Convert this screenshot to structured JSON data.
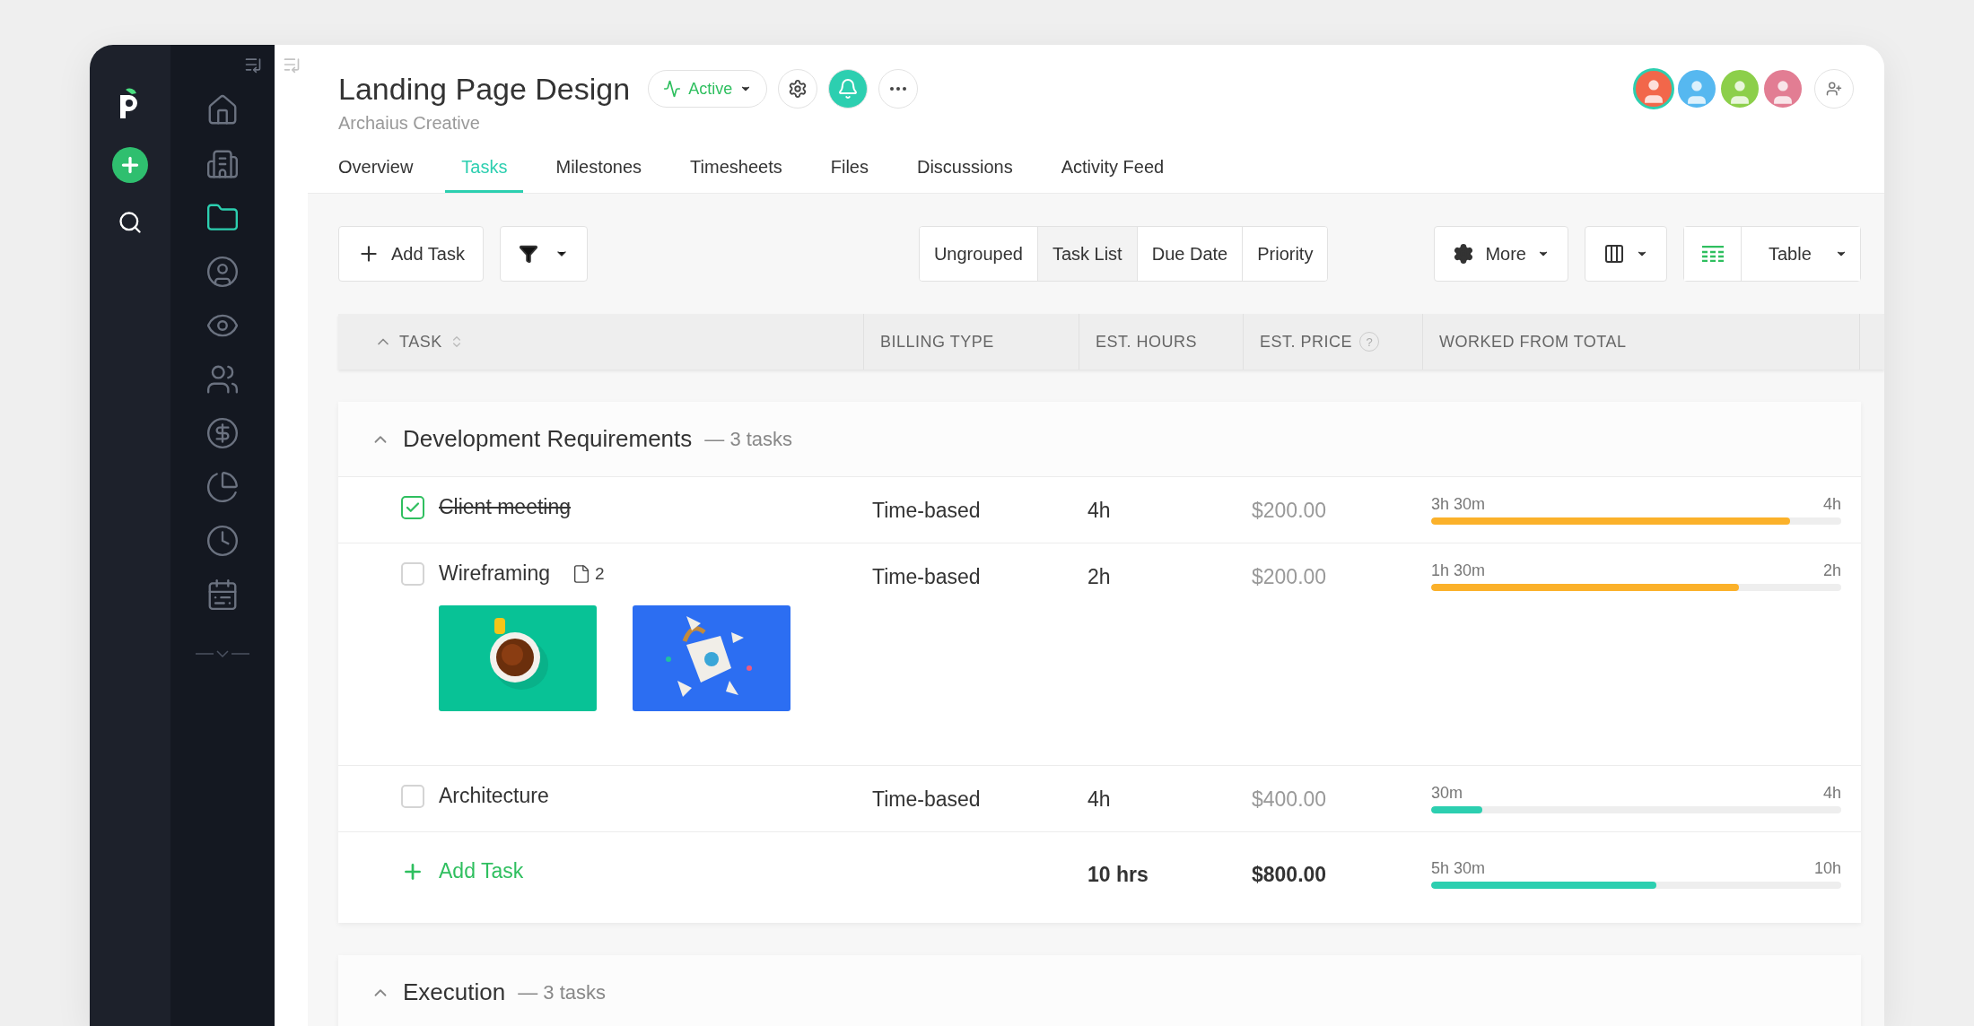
{
  "sidebar": {
    "nav": [
      {
        "selected": false
      },
      {
        "selected": false
      },
      {
        "selected": true
      },
      {
        "selected": false
      },
      {
        "selected": false
      },
      {
        "selected": false
      },
      {
        "selected": false
      },
      {
        "selected": false
      },
      {
        "selected": false
      },
      {
        "selected": false
      }
    ]
  },
  "header": {
    "title": "Landing Page Design",
    "subtitle": "Archaius Creative",
    "status": "Active",
    "avatars": [
      {
        "color": "#f2674a",
        "selected": true
      },
      {
        "color": "#56b8f0",
        "selected": false
      },
      {
        "color": "#8ccf4a",
        "selected": false
      },
      {
        "color": "#e27d93",
        "selected": false
      }
    ],
    "tabs": [
      {
        "label": "Overview",
        "selected": false
      },
      {
        "label": "Tasks",
        "selected": true
      },
      {
        "label": "Milestones",
        "selected": false
      },
      {
        "label": "Timesheets",
        "selected": false
      },
      {
        "label": "Files",
        "selected": false
      },
      {
        "label": "Discussions",
        "selected": false
      },
      {
        "label": "Activity Feed",
        "selected": false
      }
    ]
  },
  "toolbar": {
    "add_task": "Add Task",
    "grouping": [
      {
        "label": "Ungrouped",
        "selected": false
      },
      {
        "label": "Task List",
        "selected": true
      },
      {
        "label": "Due Date",
        "selected": false
      },
      {
        "label": "Priority",
        "selected": false
      }
    ],
    "more": "More",
    "view": "Table"
  },
  "table": {
    "columns": [
      {
        "label": "TASK"
      },
      {
        "label": "BILLING TYPE"
      },
      {
        "label": "EST. HOURS"
      },
      {
        "label": "EST. PRICE",
        "help": "?"
      },
      {
        "label": "WORKED FROM TOTAL"
      }
    ],
    "groups": [
      {
        "title": "Development Requirements",
        "count": "— 3 tasks",
        "expanded": true,
        "tasks": [
          {
            "name": "Client meeting",
            "checked": true,
            "billing": "Time-based",
            "hours": "4h",
            "price": "$200.00",
            "worked": {
              "done": "3h 30m",
              "total": "4h",
              "level": 0.875,
              "color": "#fbb12a"
            }
          },
          {
            "name": "Wireframing",
            "checked": false,
            "files": "2",
            "billing": "Time-based",
            "hours": "2h",
            "price": "$200.00",
            "worked": {
              "done": "1h 30m",
              "total": "2h",
              "level": 0.75,
              "color": "#fbb12a"
            }
          },
          {
            "name": "Architecture",
            "checked": false,
            "billing": "Time-based",
            "hours": "4h",
            "price": "$400.00",
            "worked": {
              "done": "30m",
              "total": "4h",
              "level": 0.125,
              "color": "#2ccfb0"
            }
          }
        ],
        "add_task": "Add Task",
        "totals": {
          "hours": "10 hrs",
          "price": "$800.00",
          "worked": {
            "done": "5h 30m",
            "total": "10h",
            "level": 0.55,
            "color": "#2ccfb0"
          }
        }
      },
      {
        "title": "Execution",
        "count": "— 3 tasks",
        "expanded": true
      }
    ]
  }
}
